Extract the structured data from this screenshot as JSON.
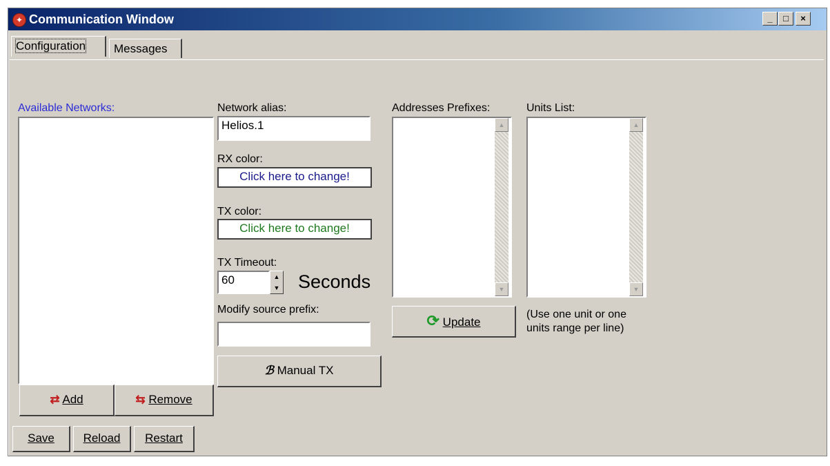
{
  "window": {
    "title": "Communication Window"
  },
  "tabs": [
    {
      "label": "Configuration"
    },
    {
      "label": "Messages"
    }
  ],
  "networks": {
    "label": "Available Networks:",
    "items": []
  },
  "alias": {
    "label": "Network alias:",
    "value": "Helios.1"
  },
  "rx": {
    "label": "RX color:",
    "text": "Click here to change!",
    "color": "#1a1a8a"
  },
  "tx": {
    "label": "TX color:",
    "text": "Click here to change!",
    "color": "#1f7a1f"
  },
  "timeout": {
    "label": "TX Timeout:",
    "value": "60",
    "unit": "Seconds"
  },
  "prefix": {
    "label": "Modify source prefix:",
    "value": ""
  },
  "buttons": {
    "manual": "Manual TX",
    "update": "Update",
    "add": "Add",
    "remove": "Remove",
    "save": "Save",
    "reload": "Reload",
    "restart": "Restart"
  },
  "addresses": {
    "label": "Addresses Prefixes:",
    "items": []
  },
  "units": {
    "label": "Units List:",
    "items": [],
    "hint": "(Use one unit or one units range per line)"
  },
  "hint_lines": [
    "(Use one unit or one",
    "units range per line)"
  ]
}
